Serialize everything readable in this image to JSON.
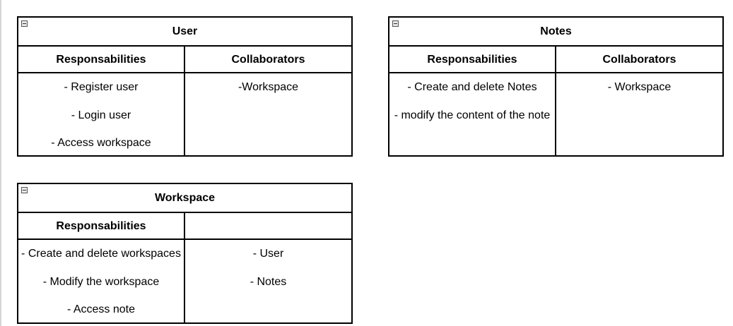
{
  "cards": {
    "user": {
      "title": "User",
      "responsibilities_label": "Responsabilities",
      "collaborators_label": "Collaborators",
      "responsibilities": [
        "- Register user",
        "- Login user",
        "- Access workspace"
      ],
      "collaborators": [
        "-Workspace"
      ]
    },
    "notes": {
      "title": "Notes",
      "responsibilities_label": "Responsabilities",
      "collaborators_label": "Collaborators",
      "responsibilities": [
        "- Create and delete Notes",
        "- modify the content of the note"
      ],
      "collaborators": [
        "- Workspace"
      ]
    },
    "workspace": {
      "title": "Workspace",
      "responsibilities_label": "Responsabilities",
      "collaborators_label": "",
      "responsibilities": [
        "- Create and delete workspaces",
        "- Modify the workspace",
        "- Access note"
      ],
      "collaborators": [
        "- User",
        "- Notes"
      ]
    }
  }
}
